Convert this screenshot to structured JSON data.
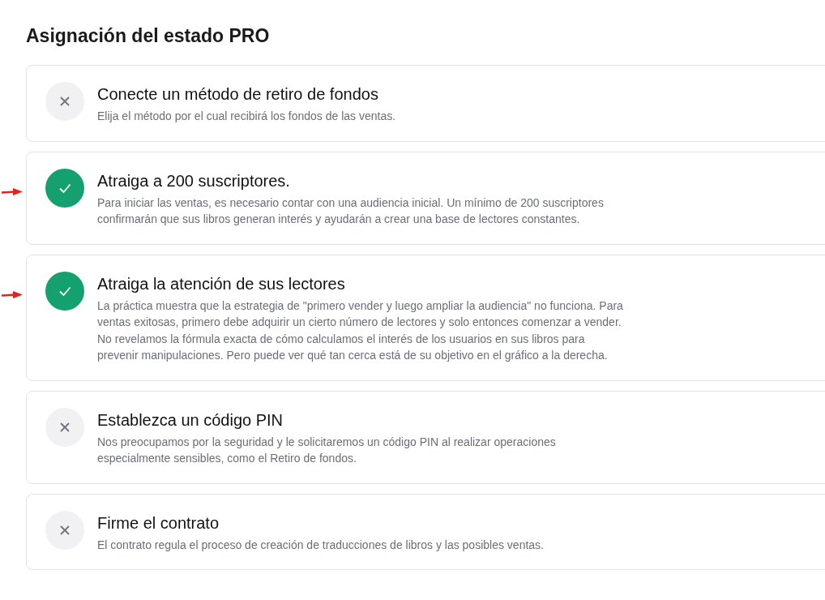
{
  "title": "Asignación del estado PRO",
  "steps": [
    {
      "title": "Conecte un método de retiro de fondos",
      "description": "Elija el método por el cual recibirá los fondos de las ventas.",
      "done": false,
      "arrow": false
    },
    {
      "title": "Atraiga a 200 suscriptores.",
      "description": "Para iniciar las ventas, es necesario contar con una audiencia inicial. Un mínimo de 200 suscriptores confirmarán que sus libros generan interés y ayudarán a crear una base de lectores constantes.",
      "done": true,
      "arrow": true
    },
    {
      "title": "Atraiga la atención de sus lectores",
      "description": "La práctica muestra que la estrategia de \"primero vender y luego ampliar la audiencia\" no funciona. Para ventas exitosas, primero debe adquirir un cierto número de lectores y solo entonces comenzar a vender. No revelamos la fórmula exacta de cómo calculamos el interés de los usuarios en sus libros para prevenir manipulaciones. Pero puede ver qué tan cerca está de su objetivo en el gráfico a la derecha.",
      "done": true,
      "arrow": true
    },
    {
      "title": "Establezca un código PIN",
      "description": "Nos preocupamos por la seguridad y le solicitaremos un código PIN al realizar operaciones especialmente sensibles, como el Retiro de fondos.",
      "done": false,
      "arrow": false
    },
    {
      "title": "Firme el contrato",
      "description": "El contrato regula el proceso de creación de traducciones de libros y las posibles ventas.",
      "done": false,
      "arrow": false
    }
  ]
}
